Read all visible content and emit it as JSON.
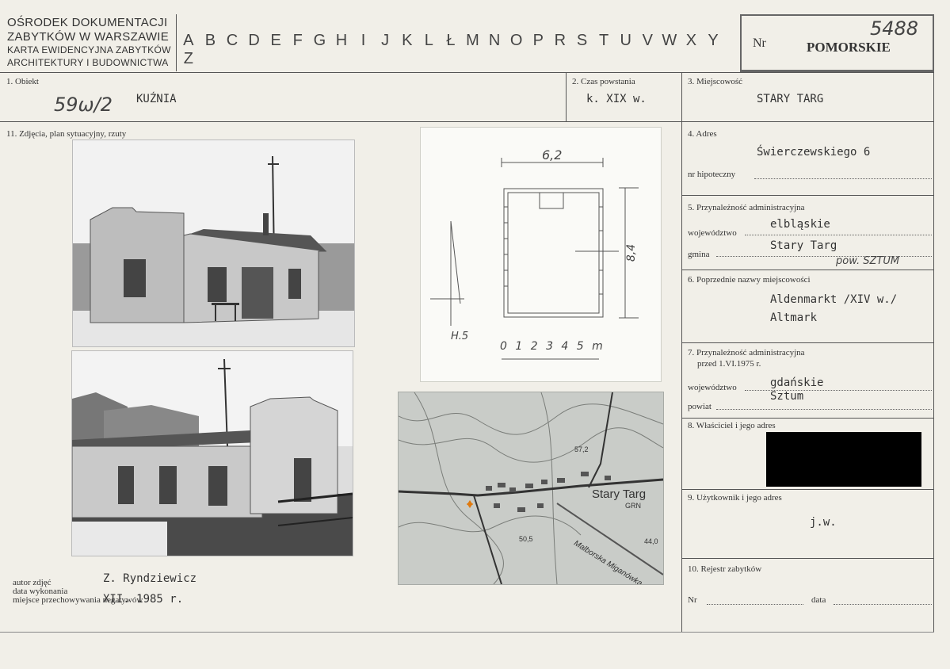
{
  "header": {
    "org_lines": [
      "OŚRODEK DOKUMENTACJI",
      "ZABYTKÓW W WARSZAWIE",
      "KARTA EWIDENCYJNA ZABYTKÓW",
      "ARCHITEKTURY I BUDOWNICTWA"
    ],
    "alphabet": [
      "A",
      "B",
      "C",
      "D",
      "E",
      "F",
      "G",
      "H",
      "I",
      "J",
      "K",
      "L",
      "Ł",
      "M",
      "N",
      "O",
      "P",
      "R",
      "S",
      "T",
      "U",
      "V",
      "W",
      "X",
      "Y",
      "Z"
    ],
    "nr_label": "Nr",
    "voivodeship": "POMORSKIE",
    "nr_value": "5488"
  },
  "fields": {
    "obiekt_label": "1. Obiekt",
    "obiekt_code": "59ω/2",
    "obiekt_value": "KUŹNIA",
    "czas_label": "2. Czas powstania",
    "czas_value": "k. XIX w.",
    "miejscowosc_label": "3. Miejscowość",
    "miejscowosc_value": "STARY TARG",
    "zdjecia_label": "11. Zdjęcia, plan sytuacyjny, rzuty",
    "adres_label": "4. Adres",
    "adres_value": "Świerczewskiego 6",
    "hipoteczny_label": "nr hipoteczny",
    "przyn_label": "5. Przynależność administracyjna",
    "woj_label": "województwo",
    "woj_value": "elbląskie",
    "gmina_label": "gmina",
    "gmina_value": "Stary Targ",
    "gmina_note": "pow. SZTUM",
    "poprz_label": "6. Poprzednie nazwy miejscowości",
    "poprz_value1": "Aldenmarkt /XIV w./",
    "poprz_value2": "Altmark",
    "przyn2_label1": "7. Przynależność administracyjna",
    "przyn2_label2": "przed 1.VI.1975 r.",
    "woj2_label": "województwo",
    "woj2_value": "gdańskie",
    "powiat_label": "powiat",
    "powiat_value": "Sztum",
    "wlasc_label": "8. Właściciel i jego adres",
    "uzytk_label": "9. Użytkownik i jego adres",
    "uzytk_value": "j.w.",
    "rejestr_label": "10. Rejestr zabytków",
    "nr_label": "Nr",
    "data_label": "data"
  },
  "footer": {
    "autor_label": "autor zdjęć",
    "data_label": "data wykonania",
    "miejsce_label": "miejsce przechowywania negatywów",
    "autor_value": "Z. Ryndziewicz",
    "data_value": "XII. 1985 r."
  },
  "plan": {
    "width_dim": "6,2",
    "depth_dim": "8,4",
    "scale_label": "0 1 2 3 4 5 m",
    "north_label": "H.5"
  },
  "map": {
    "place_label": "Stary Targ",
    "grn_label": "GRN",
    "elev1": "57,2",
    "elev2": "50,5",
    "elev3": "44,0",
    "river_label": "Malborska Miganówka"
  }
}
